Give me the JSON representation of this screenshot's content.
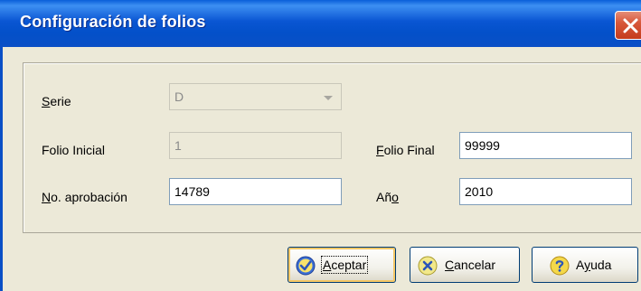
{
  "window": {
    "title": "Configuración de folios"
  },
  "form": {
    "serie": {
      "label_underlined": "S",
      "label_rest": "erie",
      "value": "D"
    },
    "folio_inicial": {
      "label": "Folio Inicial",
      "value": "1"
    },
    "folio_final": {
      "label_underlined": "F",
      "label_rest": "olio Final",
      "value": "99999"
    },
    "no_aprobacion": {
      "label_underlined": "N",
      "label_rest": "o. aprobación",
      "value": "14789"
    },
    "anio": {
      "label_pre": "Añ",
      "label_underlined": "o",
      "value": "2010"
    }
  },
  "buttons": {
    "aceptar": {
      "underlined": "A",
      "rest": "ceptar",
      "icon": "check-icon"
    },
    "cancelar": {
      "underlined": "C",
      "rest": "ancelar",
      "icon": "x-circle-icon"
    },
    "ayuda": {
      "pre": "A",
      "underlined": "y",
      "rest": "uda",
      "icon": "help-icon"
    }
  },
  "colors": {
    "titlebar": "#0a56d3",
    "dialog_bg": "#ece9d8",
    "close": "#d8583b"
  }
}
